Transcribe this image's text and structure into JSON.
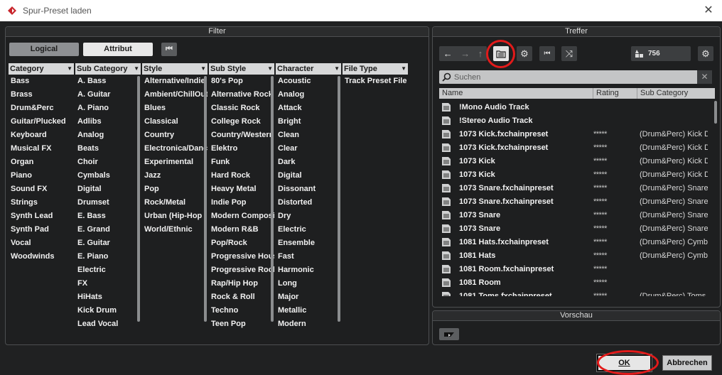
{
  "window": {
    "title": "Spur-Preset laden"
  },
  "filter": {
    "title": "Filter",
    "tabs": {
      "logical": "Logical",
      "attribut": "Attribut"
    },
    "columns": [
      {
        "header": "Category",
        "items": [
          "Bass",
          "Brass",
          "Drum&Perc",
          "Guitar/Plucked",
          "Keyboard",
          "Musical FX",
          "Organ",
          "Piano",
          "Sound FX",
          "Strings",
          "Synth Lead",
          "Synth Pad",
          "Vocal",
          "Woodwinds"
        ]
      },
      {
        "header": "Sub Category",
        "items": [
          "A. Bass",
          "A. Guitar",
          "A. Piano",
          "Adlibs",
          "Analog",
          "Beats",
          "Choir",
          "Cymbals",
          "Digital",
          "Drumset",
          "E. Bass",
          "E. Grand",
          "E. Guitar",
          "E. Piano",
          "Electric",
          "FX",
          "HiHats",
          "Kick Drum",
          "Lead Vocal"
        ]
      },
      {
        "header": "Style",
        "items": [
          "Alternative/Indie",
          "Ambient/ChillOut",
          "Blues",
          "Classical",
          "Country",
          "Electronica/Dance",
          "Experimental",
          "Jazz",
          "Pop",
          "Rock/Metal",
          "Urban (Hip-Hop / R&B)",
          "World/Ethnic"
        ]
      },
      {
        "header": "Sub Style",
        "items": [
          "80's Pop",
          "Alternative Rock",
          "Classic Rock",
          "College Rock",
          "Country/Western",
          "Elektro",
          "Funk",
          "Hard Rock",
          "Heavy Metal",
          "Indie Pop",
          "Modern Composition",
          "Modern R&B",
          "Pop/Rock",
          "Progressive House",
          "Progressive Rock",
          "Rap/Hip Hop",
          "Rock & Roll",
          "Techno",
          "Teen Pop"
        ]
      },
      {
        "header": "Character",
        "items": [
          "Acoustic",
          "Analog",
          "Attack",
          "Bright",
          "Clean",
          "Clear",
          "Dark",
          "Digital",
          "Dissonant",
          "Distorted",
          "Dry",
          "Electric",
          "Ensemble",
          "Fast",
          "Harmonic",
          "Long",
          "Major",
          "Metallic",
          "Modern"
        ]
      },
      {
        "header": "File Type",
        "items": [
          "Track Preset File"
        ]
      }
    ]
  },
  "treffer": {
    "title": "Treffer",
    "count": "756",
    "search_placeholder": "Suchen",
    "headers": {
      "name": "Name",
      "rating": "Rating",
      "subcat": "Sub Category"
    },
    "rows": [
      {
        "name": "!Mono Audio Track",
        "rating": "",
        "subcat": ""
      },
      {
        "name": "!Stereo Audio Track",
        "rating": "",
        "subcat": ""
      },
      {
        "name": "1073 Kick.fxchainpreset",
        "rating": "*****",
        "subcat": "(Drum&Perc) Kick D"
      },
      {
        "name": "1073 Kick.fxchainpreset",
        "rating": "*****",
        "subcat": "(Drum&Perc) Kick D"
      },
      {
        "name": "1073 Kick",
        "rating": "*****",
        "subcat": "(Drum&Perc) Kick D"
      },
      {
        "name": "1073 Kick",
        "rating": "*****",
        "subcat": "(Drum&Perc) Kick D"
      },
      {
        "name": "1073 Snare.fxchainpreset",
        "rating": "*****",
        "subcat": "(Drum&Perc) Snare"
      },
      {
        "name": "1073 Snare.fxchainpreset",
        "rating": "*****",
        "subcat": "(Drum&Perc) Snare"
      },
      {
        "name": "1073 Snare",
        "rating": "*****",
        "subcat": "(Drum&Perc) Snare"
      },
      {
        "name": "1073 Snare",
        "rating": "*****",
        "subcat": "(Drum&Perc) Snare"
      },
      {
        "name": "1081 Hats.fxchainpreset",
        "rating": "*****",
        "subcat": "(Drum&Perc) Cymba"
      },
      {
        "name": "1081 Hats",
        "rating": "*****",
        "subcat": "(Drum&Perc) Cymba"
      },
      {
        "name": "1081 Room.fxchainpreset",
        "rating": "*****",
        "subcat": ""
      },
      {
        "name": "1081 Room",
        "rating": "*****",
        "subcat": ""
      },
      {
        "name": "1081 Toms.fxchainpreset",
        "rating": "*****",
        "subcat": "(Drum&Perc) Toms"
      }
    ]
  },
  "vorschau": {
    "title": "Vorschau"
  },
  "buttons": {
    "ok": "OK",
    "cancel": "Abbrechen"
  },
  "colors": {
    "highlight": "#e21a1a",
    "background": "#202122"
  }
}
